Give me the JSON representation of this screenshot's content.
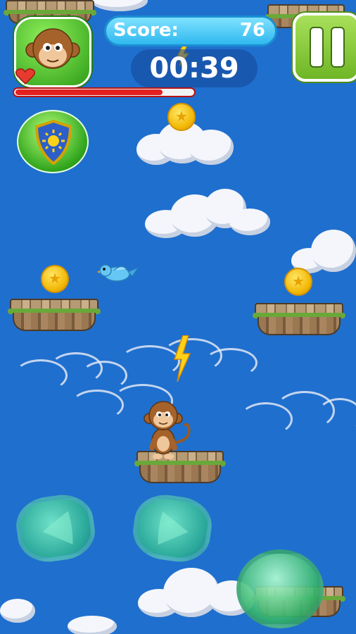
{
  "hud": {
    "score_label": "Score:",
    "score_value": "76",
    "timer": "00:39",
    "health_fraction": 0.83
  },
  "icons": {
    "player_avatar": "monkey-face-icon",
    "life": "heart-icon",
    "shield_powerup": "shield-sun-icon",
    "pause": "pause-icon",
    "coin": "star-coin-icon",
    "bolt": "lightning-bolt-icon",
    "enemy": "blue-bird-icon"
  },
  "colors": {
    "sky": "#1f6fce",
    "score_pill": "#2fb8ef",
    "health": "#e32020",
    "pause_button": "#6fb625",
    "coin": "#f2b705"
  }
}
